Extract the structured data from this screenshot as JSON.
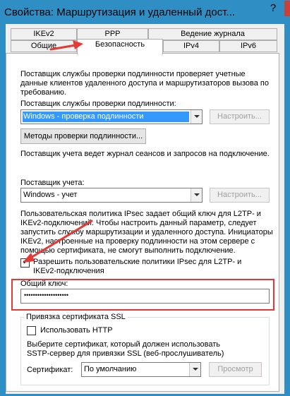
{
  "window": {
    "title": "Свойства: Маршрутизация и удаленный дост...",
    "help_label": "?"
  },
  "tabs": [
    {
      "label": "IKEv2"
    },
    {
      "label": "PPP"
    },
    {
      "label": "Ведение журнала"
    },
    {
      "label": "Общие"
    },
    {
      "label": "Безопасность"
    },
    {
      "label": "IPv4"
    },
    {
      "label": "IPv6"
    }
  ],
  "auth": {
    "description": [
      "Поставщик службы проверки подлинности проверяет учетные",
      "данные клиентов удаленного доступа и маршрутизаторов вызова по",
      "требованию."
    ],
    "provider_label": "Поставщик службы проверки подлинности:",
    "provider_value": "Windows - проверка подлинности",
    "configure_label": "Настроить...",
    "methods_label": "Методы проверки подлинности...",
    "log_note": "Поставщик учета ведет журнал сеансов и запросов на подключение."
  },
  "accounting": {
    "provider_label": "Поставщик учета:",
    "provider_value": "Windows - учет",
    "configure_label": "Настроить..."
  },
  "ipsec": {
    "description": [
      "Пользовательская политика IPsec задает общий ключ для L2TP- и",
      "IKEv2-подключений. Чтобы настроить данный параметр, следует",
      "запустить службу маршрутизации и удаленного доступа. Инициаторы",
      "IKEv2, настроенные на проверку подлинности на этом сервере с",
      "помощью сертификата, не смогут выполнить подключение."
    ],
    "allow_label": [
      "Разрешить пользовательские политики IPsec для L2TP- и",
      "IKEv2-подключения"
    ],
    "allow_checked": true,
    "check_mark": "✔",
    "shared_key_label": "Общий ключ:",
    "shared_key_value": "••••••••••••••••••••"
  },
  "ssl": {
    "group_title": "Привязка сертификата SSL",
    "use_http_label": "Использовать HTTP",
    "use_http_checked": false,
    "description": [
      "Выберите сертификат, который должен использовать",
      "SSTP-сервер для привязки SSL (веб-прослушиватель)"
    ],
    "cert_label": "Сертификат:",
    "cert_value": "По умолчанию",
    "browse_label": "Просмотр"
  },
  "annotation_color": "#e53935"
}
